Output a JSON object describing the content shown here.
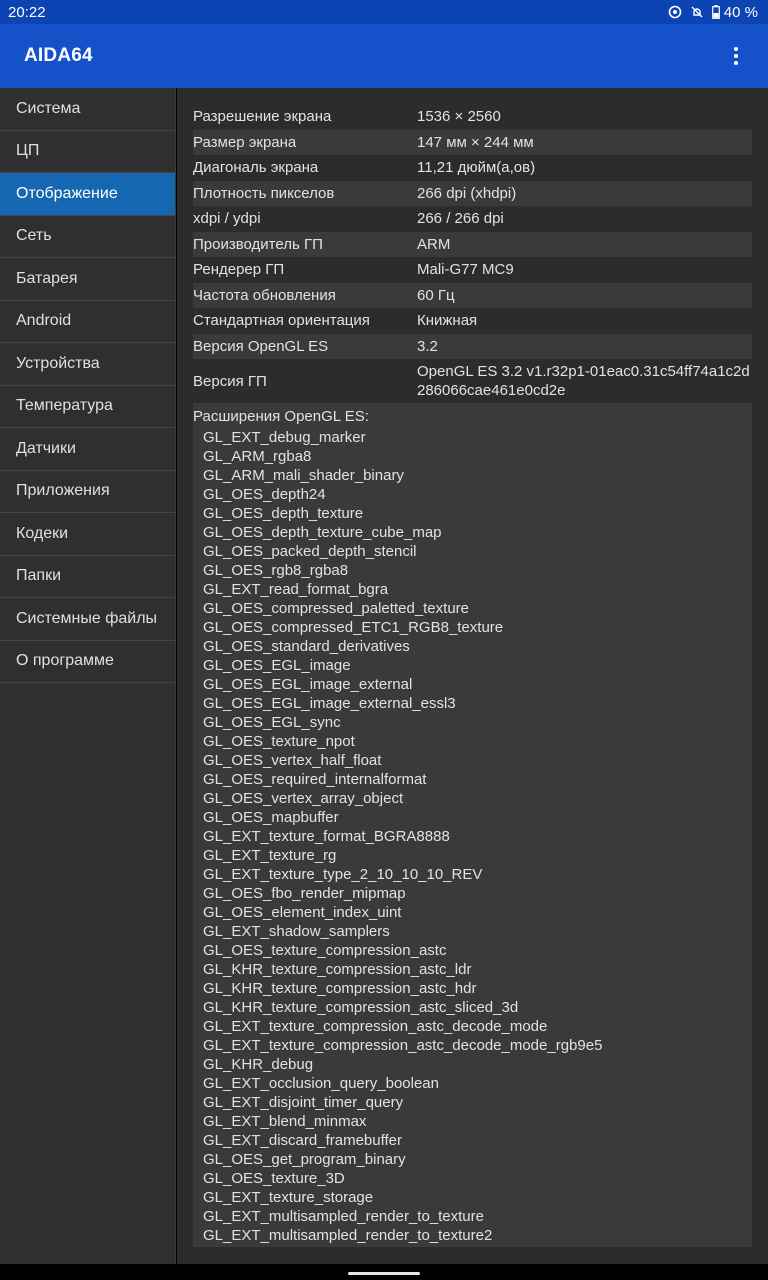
{
  "status_bar": {
    "time": "20:22",
    "battery": "40 %",
    "icons": [
      "cast-icon",
      "mute-icon",
      "battery-icon"
    ]
  },
  "app_bar": {
    "title": "AIDA64",
    "menu_icon": "more-vert-icon"
  },
  "sidebar": {
    "active_index": 2,
    "items": [
      {
        "label": "Система"
      },
      {
        "label": "ЦП"
      },
      {
        "label": "Отображение"
      },
      {
        "label": "Сеть"
      },
      {
        "label": "Батарея"
      },
      {
        "label": "Android"
      },
      {
        "label": "Устройства"
      },
      {
        "label": "Температура"
      },
      {
        "label": "Датчики"
      },
      {
        "label": "Приложения"
      },
      {
        "label": "Кодеки"
      },
      {
        "label": "Папки"
      },
      {
        "label": "Системные файлы"
      },
      {
        "label": "О программе"
      }
    ]
  },
  "display_info": {
    "rows": [
      {
        "key": "Разрешение экрана",
        "value": "1536 × 2560"
      },
      {
        "key": "Размер экрана",
        "value": "147 мм × 244 мм"
      },
      {
        "key": "Диагональ экрана",
        "value": "11,21 дюйм(а,ов)"
      },
      {
        "key": "Плотность пикселов",
        "value": "266 dpi (xhdpi)"
      },
      {
        "key": "xdpi / ydpi",
        "value": "266 / 266 dpi"
      },
      {
        "key": "Производитель ГП",
        "value": "ARM"
      },
      {
        "key": "Рендерер ГП",
        "value": "Mali-G77 MC9"
      },
      {
        "key": "Частота обновления",
        "value": "60 Гц"
      },
      {
        "key": "Стандартная ориентация",
        "value": "Книжная"
      },
      {
        "key": "Версия OpenGL ES",
        "value": "3.2"
      },
      {
        "key": "Версия ГП",
        "value": "OpenGL ES 3.2 v1.r32p1-01eac0.31c54ff74a1c2d286066cae461e0cd2e"
      }
    ],
    "extensions_title": "Расширения OpenGL ES:",
    "extensions": [
      "GL_EXT_debug_marker",
      "GL_ARM_rgba8",
      "GL_ARM_mali_shader_binary",
      "GL_OES_depth24",
      "GL_OES_depth_texture",
      "GL_OES_depth_texture_cube_map",
      "GL_OES_packed_depth_stencil",
      "GL_OES_rgb8_rgba8",
      "GL_EXT_read_format_bgra",
      "GL_OES_compressed_paletted_texture",
      "GL_OES_compressed_ETC1_RGB8_texture",
      "GL_OES_standard_derivatives",
      "GL_OES_EGL_image",
      "GL_OES_EGL_image_external",
      "GL_OES_EGL_image_external_essl3",
      "GL_OES_EGL_sync",
      "GL_OES_texture_npot",
      "GL_OES_vertex_half_float",
      "GL_OES_required_internalformat",
      "GL_OES_vertex_array_object",
      "GL_OES_mapbuffer",
      "GL_EXT_texture_format_BGRA8888",
      "GL_EXT_texture_rg",
      "GL_EXT_texture_type_2_10_10_10_REV",
      "GL_OES_fbo_render_mipmap",
      "GL_OES_element_index_uint",
      "GL_EXT_shadow_samplers",
      "GL_OES_texture_compression_astc",
      "GL_KHR_texture_compression_astc_ldr",
      "GL_KHR_texture_compression_astc_hdr",
      "GL_KHR_texture_compression_astc_sliced_3d",
      "GL_EXT_texture_compression_astc_decode_mode",
      "GL_EXT_texture_compression_astc_decode_mode_rgb9e5",
      "GL_KHR_debug",
      "GL_EXT_occlusion_query_boolean",
      "GL_EXT_disjoint_timer_query",
      "GL_EXT_blend_minmax",
      "GL_EXT_discard_framebuffer",
      "GL_OES_get_program_binary",
      "GL_OES_texture_3D",
      "GL_EXT_texture_storage",
      "GL_EXT_multisampled_render_to_texture",
      "GL_EXT_multisampled_render_to_texture2"
    ]
  },
  "colors": {
    "status_bar": "#0d44b4",
    "app_bar": "#1551c9",
    "sidebar_active": "#1467b0",
    "background": "#2c2c2c"
  }
}
